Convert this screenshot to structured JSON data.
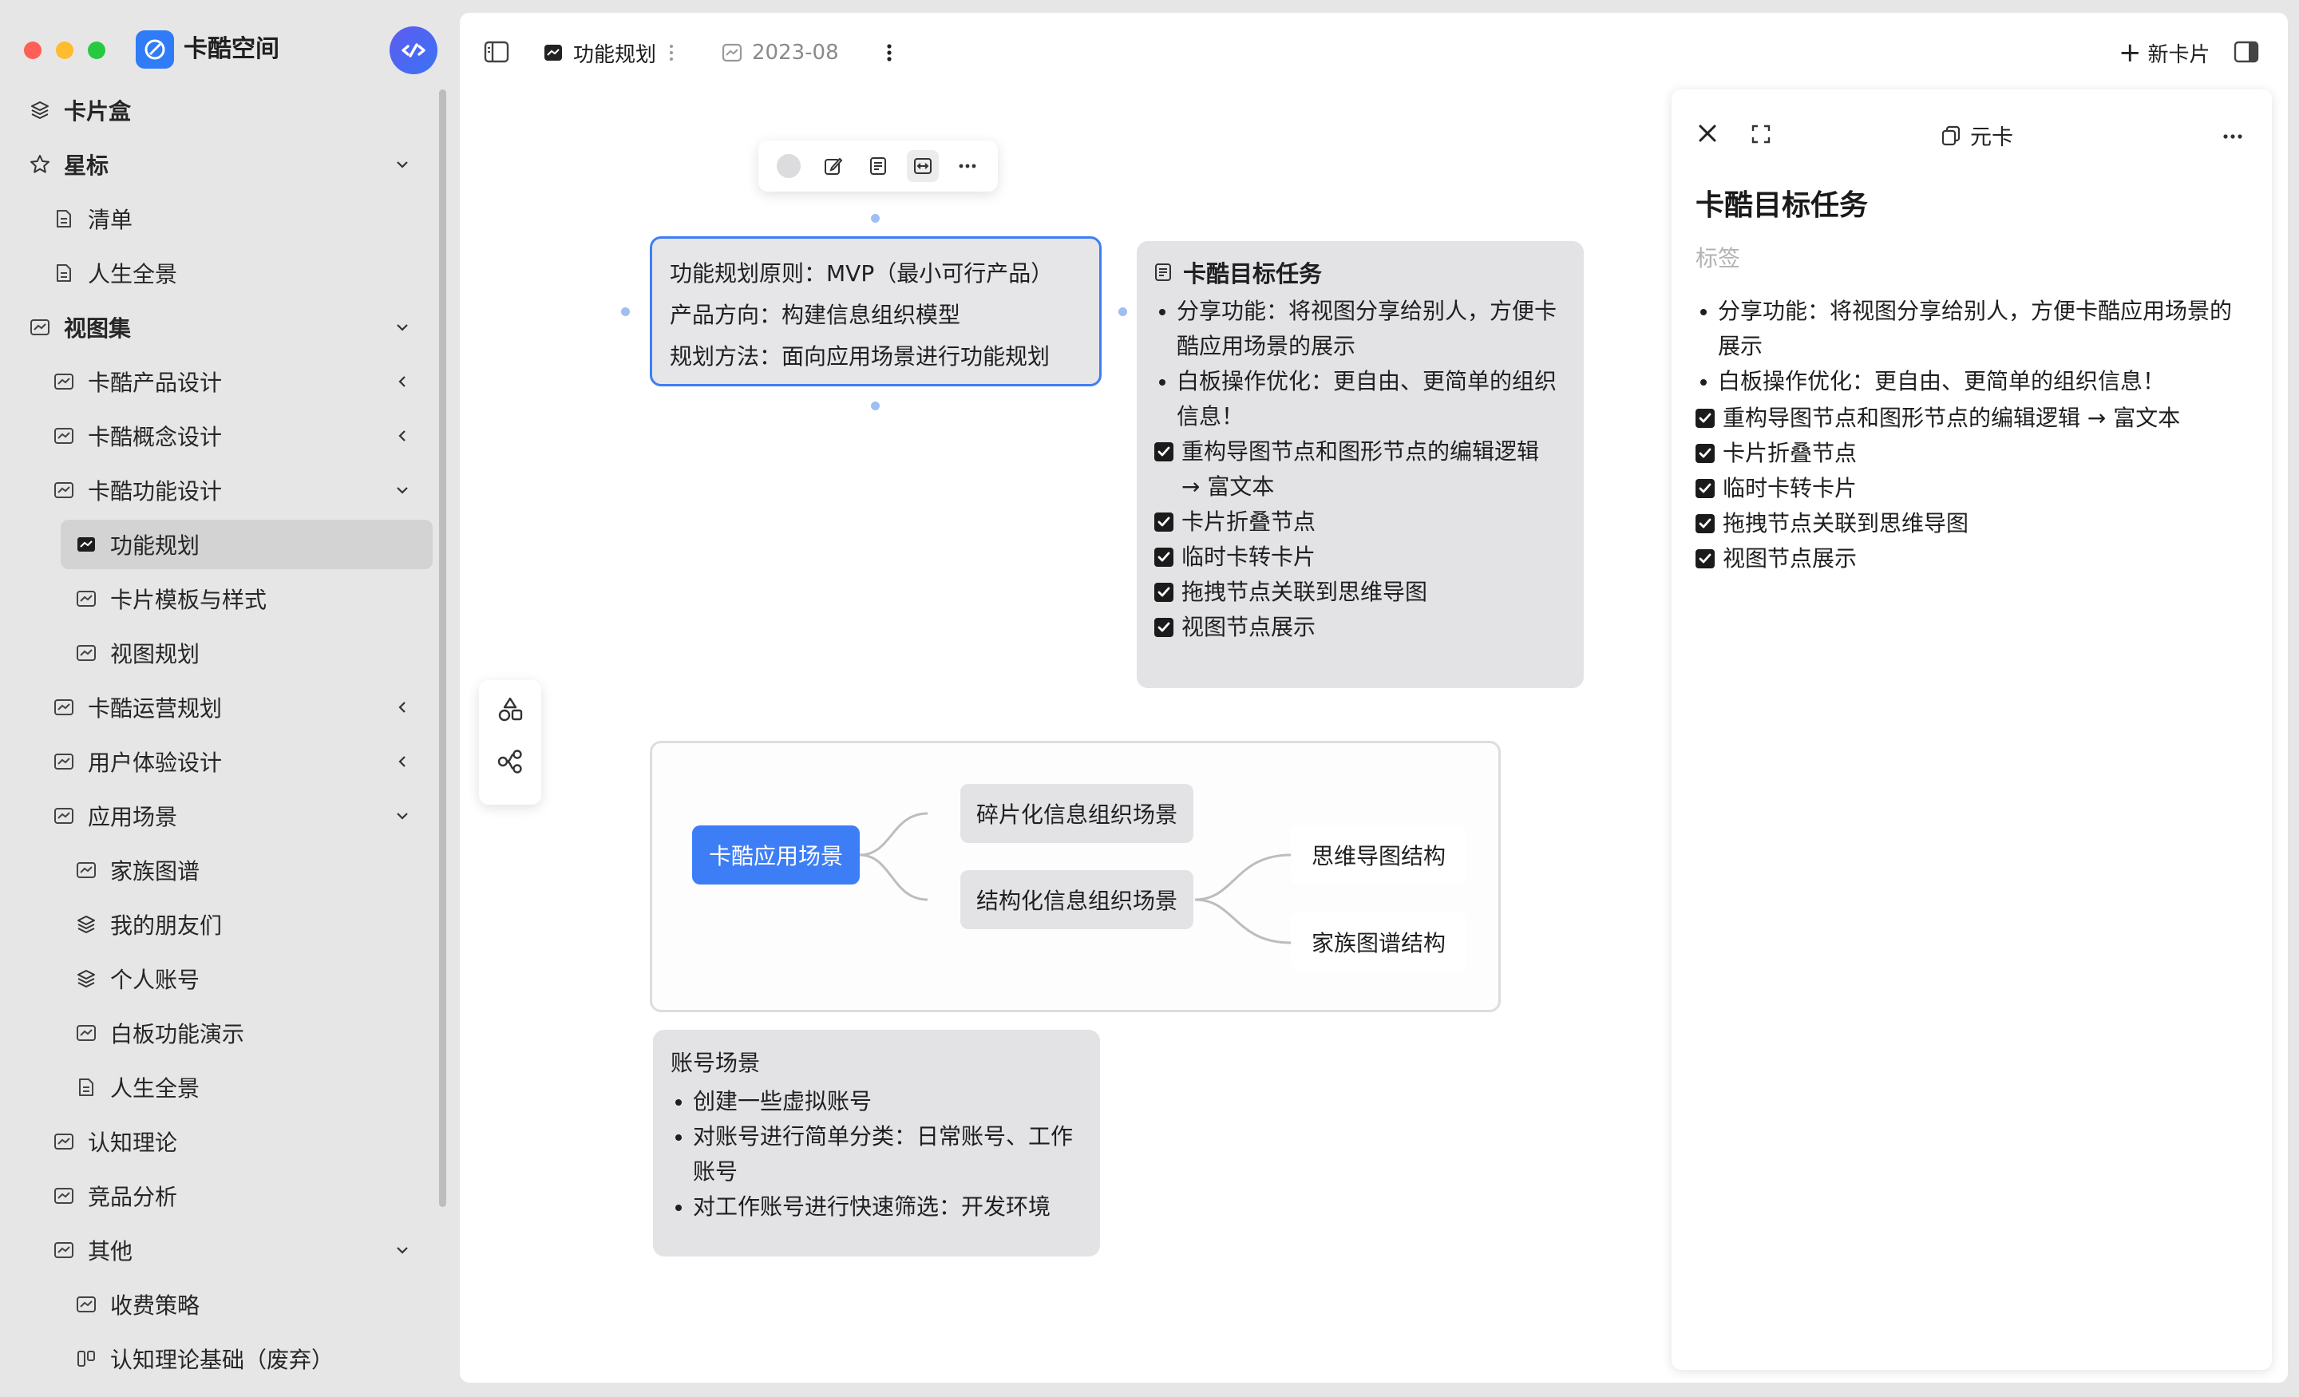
{
  "app": {
    "title": "卡酷空间"
  },
  "sidebar": {
    "items": [
      {
        "label": "卡片盒",
        "icon": "layers-icon",
        "bold": true,
        "expand": "none"
      },
      {
        "label": "星标",
        "icon": "star-icon",
        "bold": true,
        "expand": "down"
      },
      {
        "label": "清单",
        "icon": "document-icon",
        "expand": "none"
      },
      {
        "label": "人生全景",
        "icon": "document-icon",
        "expand": "none"
      },
      {
        "label": "视图集",
        "icon": "view-icon",
        "bold": true,
        "expand": "down"
      },
      {
        "label": "卡酷产品设计",
        "icon": "view-icon",
        "expand": "left"
      },
      {
        "label": "卡酷概念设计",
        "icon": "view-icon",
        "expand": "left"
      },
      {
        "label": "卡酷功能设计",
        "icon": "view-icon",
        "expand": "down"
      },
      {
        "label": "功能规划",
        "icon": "view-icon",
        "active": true,
        "expand": "none"
      },
      {
        "label": "卡片模板与样式",
        "icon": "view-icon",
        "expand": "none"
      },
      {
        "label": "视图规划",
        "icon": "view-icon",
        "expand": "none"
      },
      {
        "label": "卡酷运营规划",
        "icon": "view-icon",
        "expand": "left"
      },
      {
        "label": "用户体验设计",
        "icon": "view-icon",
        "expand": "left"
      },
      {
        "label": "应用场景",
        "icon": "view-icon",
        "expand": "down"
      },
      {
        "label": "家族图谱",
        "icon": "view-icon",
        "expand": "none"
      },
      {
        "label": "我的朋友们",
        "icon": "layers-icon",
        "expand": "none"
      },
      {
        "label": "个人账号",
        "icon": "layers-icon",
        "expand": "none"
      },
      {
        "label": "白板功能演示",
        "icon": "view-icon",
        "expand": "none"
      },
      {
        "label": "人生全景",
        "icon": "document-icon",
        "expand": "none"
      },
      {
        "label": "认知理论",
        "icon": "view-icon",
        "expand": "none"
      },
      {
        "label": "竞品分析",
        "icon": "view-icon",
        "expand": "none"
      },
      {
        "label": "其他",
        "icon": "view-icon",
        "expand": "down"
      },
      {
        "label": "收费策略",
        "icon": "view-icon",
        "expand": "none"
      },
      {
        "label": "认知理论基础（废弃）",
        "icon": "kanban-icon",
        "expand": "none"
      }
    ]
  },
  "topbar": {
    "tab_title": "功能规划",
    "tab_secondary": "2023-08",
    "new_card": "新卡片"
  },
  "canvas": {
    "main_node": {
      "lines": [
        "功能规划原则：MVP（最小可行产品）",
        "产品方向：构建信息组织模型",
        "规划方法：面向应用场景进行功能规划"
      ]
    },
    "target_card": {
      "title": "卡酷目标任务",
      "bullets": [
        [
          "分享功能：将视图分享给别人，方便卡",
          "酷应用场景的展示"
        ],
        [
          "白板操作优化：更自由、更简单的组织",
          "信息！"
        ]
      ],
      "checks": [
        [
          "重构导图节点和图形节点的编辑逻辑",
          "→ 富文本"
        ],
        [
          "卡片折叠节点"
        ],
        [
          "临时卡转卡片"
        ],
        [
          "拖拽节点关联到思维导图"
        ],
        [
          "视图节点展示"
        ]
      ]
    },
    "mindmap": {
      "root": "卡酷应用场景",
      "mid": [
        "碎片化信息组织场景",
        "结构化信息组织场景"
      ],
      "leaves": [
        "思维导图结构",
        "家族图谱结构"
      ]
    },
    "account_card": {
      "title": "账号场景",
      "bullets": [
        [
          "创建一些虚拟账号"
        ],
        [
          "对账号进行简单分类：日常账号、工作",
          "账号"
        ],
        [
          "对工作账号进行快速筛选：开发环境"
        ]
      ]
    }
  },
  "detail_panel": {
    "header_label": "元卡",
    "title": "卡酷目标任务",
    "tag_placeholder": "标签",
    "bullets": [
      [
        "分享功能：将视图分享给别人，方便卡酷应用场景的",
        "展示"
      ],
      [
        "白板操作优化：更自由、更简单的组织信息！"
      ]
    ],
    "checks": [
      "重构导图节点和图形节点的编辑逻辑 → 富文本",
      "卡片折叠节点",
      "临时卡转卡片",
      "拖拽节点关联到思维导图",
      "视图节点展示"
    ]
  },
  "colors": {
    "accent": "#3d7ef6",
    "card_bg": "#e3e3e6",
    "sidebar_active": "#d3d3d3"
  }
}
